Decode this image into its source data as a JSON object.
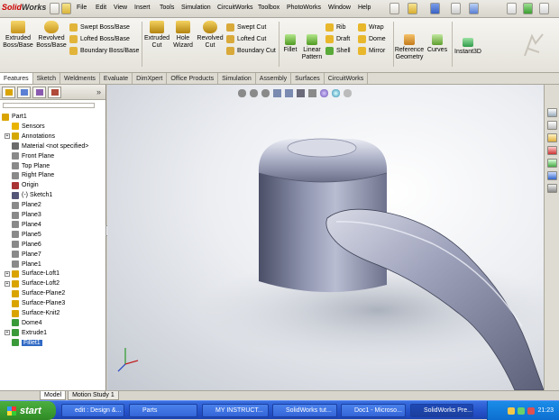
{
  "app": {
    "name_a": "Solid",
    "name_b": "Works"
  },
  "menu": [
    "File",
    "Edit",
    "View",
    "Insert",
    "Tools",
    "Simulation",
    "CircuitWorks",
    "Toolbox",
    "PhotoWorks",
    "Window",
    "Help"
  ],
  "commands": {
    "extruded_boss": "Extruded Boss/Base",
    "revolved_boss": "Revolved Boss/Base",
    "swept_boss": "Swept Boss/Base",
    "lofted_boss": "Lofted Boss/Base",
    "boundary_boss": "Boundary Boss/Base",
    "extruded_cut": "Extruded Cut",
    "hole_wizard": "Hole Wizard",
    "revolved_cut": "Revolved Cut",
    "swept_cut": "Swept Cut",
    "lofted_cut": "Lofted Cut",
    "boundary_cut": "Boundary Cut",
    "fillet": "Fillet",
    "linear_pattern": "Linear Pattern",
    "rib": "Rib",
    "draft": "Draft",
    "shell": "Shell",
    "wrap": "Wrap",
    "dome": "Dome",
    "mirror": "Mirror",
    "reference_geometry": "Reference Geometry",
    "curves": "Curves",
    "instant3d": "Instant3D"
  },
  "tabs": [
    "Features",
    "Sketch",
    "Weldments",
    "Evaluate",
    "DimXpert",
    "Office Products",
    "Simulation",
    "Assembly",
    "Surfaces",
    "CircuitWorks"
  ],
  "tree": [
    {
      "label": "Part1",
      "icon": "part-icon",
      "color": "#d9a400",
      "indent": 0,
      "plus": false
    },
    {
      "label": "Sensors",
      "icon": "sensor-icon",
      "color": "#e8b400",
      "indent": 1,
      "plus": false
    },
    {
      "label": "Annotations",
      "icon": "annotation-icon",
      "color": "#d4a800",
      "indent": 1,
      "plus": true
    },
    {
      "label": "Material <not specified>",
      "icon": "material-icon",
      "color": "#6b6b6b",
      "indent": 1,
      "plus": false
    },
    {
      "label": "Front Plane",
      "icon": "plane-icon",
      "color": "#8a8a8a",
      "indent": 1,
      "plus": false
    },
    {
      "label": "Top Plane",
      "icon": "plane-icon",
      "color": "#8a8a8a",
      "indent": 1,
      "plus": false
    },
    {
      "label": "Right Plane",
      "icon": "plane-icon",
      "color": "#8a8a8a",
      "indent": 1,
      "plus": false
    },
    {
      "label": "Origin",
      "icon": "origin-icon",
      "color": "#a33",
      "indent": 1,
      "plus": false
    },
    {
      "label": "(-) Sketch1",
      "icon": "sketch-icon",
      "color": "#557",
      "indent": 1,
      "plus": false
    },
    {
      "label": "Plane2",
      "icon": "plane-icon",
      "color": "#8a8a8a",
      "indent": 1,
      "plus": false
    },
    {
      "label": "Plane3",
      "icon": "plane-icon",
      "color": "#8a8a8a",
      "indent": 1,
      "plus": false
    },
    {
      "label": "Plane4",
      "icon": "plane-icon",
      "color": "#8a8a8a",
      "indent": 1,
      "plus": false
    },
    {
      "label": "Plane5",
      "icon": "plane-icon",
      "color": "#8a8a8a",
      "indent": 1,
      "plus": false
    },
    {
      "label": "Plane6",
      "icon": "plane-icon",
      "color": "#8a8a8a",
      "indent": 1,
      "plus": false
    },
    {
      "label": "Plane7",
      "icon": "plane-icon",
      "color": "#8a8a8a",
      "indent": 1,
      "plus": false
    },
    {
      "label": "Plane1",
      "icon": "plane-icon",
      "color": "#8a8a8a",
      "indent": 1,
      "plus": false
    },
    {
      "label": "Surface-Loft1",
      "icon": "surface-loft-icon",
      "color": "#d9a400",
      "indent": 1,
      "plus": true
    },
    {
      "label": "Surface-Loft2",
      "icon": "surface-loft-icon",
      "color": "#d9a400",
      "indent": 1,
      "plus": true
    },
    {
      "label": "Surface-Plane2",
      "icon": "surface-plane-icon",
      "color": "#d9a400",
      "indent": 1,
      "plus": false
    },
    {
      "label": "Surface-Plane3",
      "icon": "surface-plane-icon",
      "color": "#d9a400",
      "indent": 1,
      "plus": false
    },
    {
      "label": "Surface-Knit2",
      "icon": "surface-knit-icon",
      "color": "#d9a400",
      "indent": 1,
      "plus": false
    },
    {
      "label": "Dome4",
      "icon": "dome-icon",
      "color": "#3a9a3a",
      "indent": 1,
      "plus": false
    },
    {
      "label": "Extrude1",
      "icon": "extrude-icon",
      "color": "#3a9a3a",
      "indent": 1,
      "plus": true
    },
    {
      "label": "Fillet1",
      "icon": "fillet-icon",
      "color": "#3a9a3a",
      "indent": 1,
      "plus": false,
      "selected": true
    }
  ],
  "bottom_tabs": [
    "Model",
    "Motion Study 1"
  ],
  "taskbar": {
    "start": "start",
    "tasks": [
      "edit : Design &...",
      "Parts",
      "MY INSTRUCT...",
      "SolidWorks tut...",
      "Doc1 - Microso...",
      "SolidWorks Pre..."
    ],
    "clock": "21:23"
  },
  "colors": {
    "selection": "#316ac5",
    "model": "#8f93ae",
    "taskbar": "#2451c8"
  }
}
